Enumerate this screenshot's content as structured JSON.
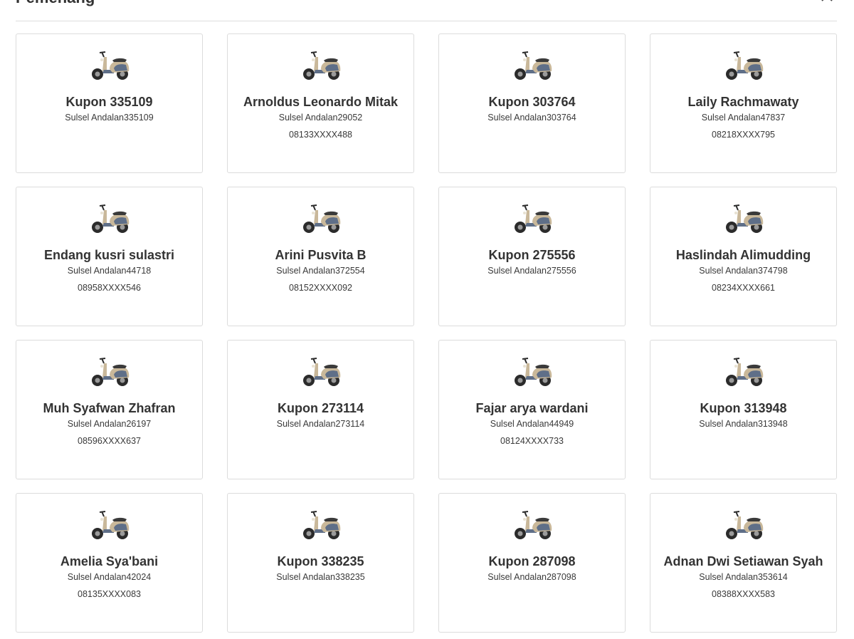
{
  "section": {
    "title": "Pemenang",
    "toggle_icon": "chevron-up-icon"
  },
  "winners": [
    {
      "name": "Kupon 335109",
      "code": "Sulsel Andalan335109",
      "phone": ""
    },
    {
      "name": "Arnoldus Leonardo Mitak",
      "code": "Sulsel Andalan29052",
      "phone": "08133XXXX488"
    },
    {
      "name": "Kupon 303764",
      "code": "Sulsel Andalan303764",
      "phone": ""
    },
    {
      "name": "Laily Rachmawaty",
      "code": "Sulsel Andalan47837",
      "phone": "08218XXXX795"
    },
    {
      "name": "Endang kusri sulastri",
      "code": "Sulsel Andalan44718",
      "phone": "08958XXXX546"
    },
    {
      "name": "Arini Pusvita B",
      "code": "Sulsel Andalan372554",
      "phone": "08152XXXX092"
    },
    {
      "name": "Kupon 275556",
      "code": "Sulsel Andalan275556",
      "phone": ""
    },
    {
      "name": "Haslindah Alimudding",
      "code": "Sulsel Andalan374798",
      "phone": "08234XXXX661"
    },
    {
      "name": "Muh Syafwan Zhafran",
      "code": "Sulsel Andalan26197",
      "phone": "08596XXXX637"
    },
    {
      "name": "Kupon 273114",
      "code": "Sulsel Andalan273114",
      "phone": ""
    },
    {
      "name": "Fajar arya wardani",
      "code": "Sulsel Andalan44949",
      "phone": "08124XXXX733"
    },
    {
      "name": "Kupon 313948",
      "code": "Sulsel Andalan313948",
      "phone": ""
    },
    {
      "name": "Amelia Sya'bani",
      "code": "Sulsel Andalan42024",
      "phone": "08135XXXX083"
    },
    {
      "name": "Kupon 338235",
      "code": "Sulsel Andalan338235",
      "phone": ""
    },
    {
      "name": "Kupon 287098",
      "code": "Sulsel Andalan287098",
      "phone": ""
    },
    {
      "name": "Adnan Dwi Setiawan Syah",
      "code": "Sulsel Andalan353614",
      "phone": "08388XXXX583"
    }
  ],
  "prize_icon": "scooter-icon",
  "colors": {
    "scooter_body": "#c9b89a",
    "scooter_panel": "#5f6f88",
    "scooter_dark": "#2b2b2b",
    "border": "#dcdcdc"
  }
}
